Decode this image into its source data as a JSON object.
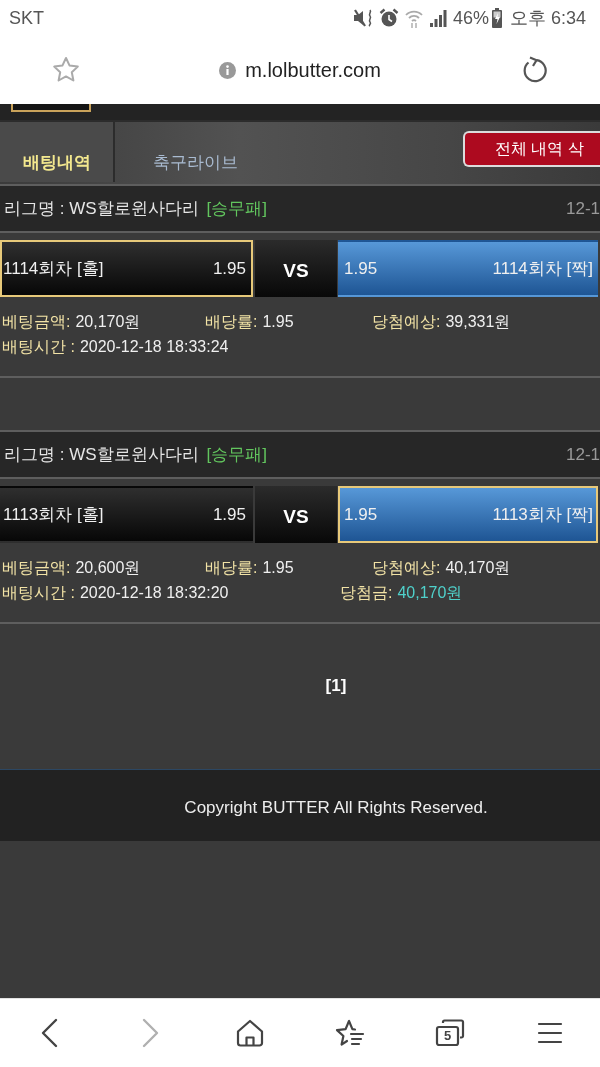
{
  "status_bar": {
    "carrier": "SKT",
    "battery": "46%",
    "time": "오후 6:34"
  },
  "address_bar": {
    "url": "m.lolbutter.com"
  },
  "tabs": [
    {
      "label": "배팅내역",
      "selected": true
    },
    {
      "label": "축구라이브",
      "selected": false
    }
  ],
  "delete_button": {
    "label": "전체 내역 삭"
  },
  "bets": [
    {
      "league": "리그명 : WS할로윈사다리",
      "market": "[승무패]",
      "date": "12-1",
      "home": {
        "name": "1114회차 [홀]",
        "odds": "1.95",
        "selected": true
      },
      "vs": "VS",
      "away": {
        "odds": "1.95",
        "name": "1114회차 [짝]",
        "selected": false
      },
      "detail_lines": [
        [
          {
            "label": "베팅금액:",
            "value": "20,170원",
            "kind": "info"
          },
          {
            "label": "배당률:",
            "value": "1.95",
            "kind": "info"
          },
          {
            "label": "당첨예상:",
            "value": "39,331원",
            "kind": "info"
          }
        ],
        [
          {
            "label": "배팅시간 :",
            "value": "2020-12-18 18:33:24",
            "kind": "info"
          }
        ]
      ]
    },
    {
      "league": "리그명 : WS할로윈사다리",
      "market": "[승무패]",
      "date": "12-1",
      "home": {
        "name": "1113회차 [홀]",
        "odds": "1.95",
        "selected": false
      },
      "vs": "VS",
      "away": {
        "odds": "1.95",
        "name": "1113회차 [짝]",
        "selected": true
      },
      "detail_lines": [
        [
          {
            "label": "베팅금액:",
            "value": "20,600원",
            "kind": "info"
          },
          {
            "label": "배당률:",
            "value": "1.95",
            "kind": "info"
          },
          {
            "label": "당첨예상:",
            "value": "40,170원",
            "kind": "info"
          }
        ],
        [
          {
            "label": "배팅시간 :",
            "value": "2020-12-18 18:32:20",
            "kind": "info"
          },
          {
            "label": "당첨금:",
            "value": "40,170원",
            "kind": "payout"
          }
        ]
      ]
    }
  ],
  "pagination": {
    "label": "[1]"
  },
  "footer": {
    "copyright": "Copyright BUTTER All Rights Reserved."
  },
  "bottom_nav": [
    {
      "kind": "back",
      "disabled": false
    },
    {
      "kind": "forward",
      "disabled": true
    },
    {
      "kind": "home",
      "disabled": false
    },
    {
      "kind": "bookmarks",
      "disabled": false
    },
    {
      "kind": "tabs",
      "disabled": false,
      "count": "5"
    },
    {
      "kind": "menu",
      "disabled": false
    }
  ]
}
